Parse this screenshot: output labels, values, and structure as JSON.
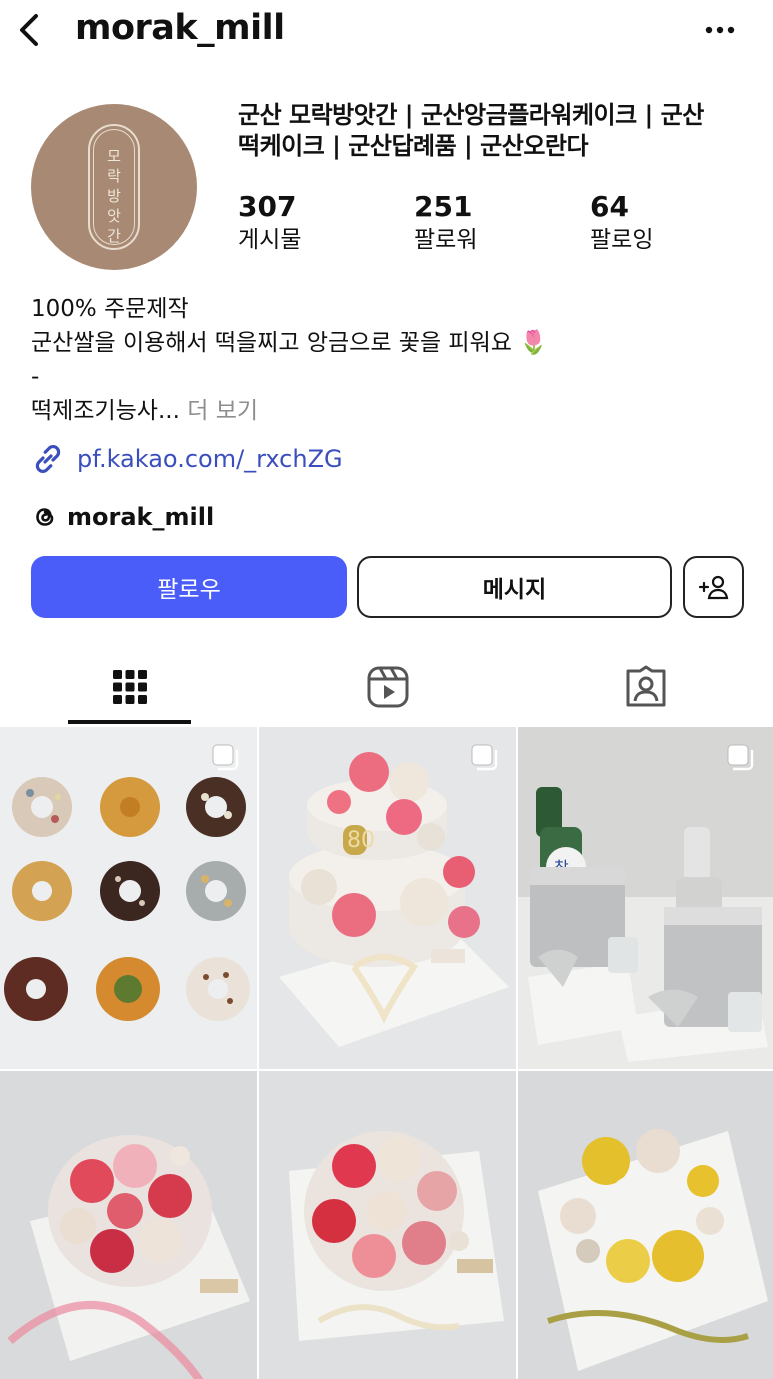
{
  "header": {
    "username": "morak_mill"
  },
  "avatar": {
    "text": [
      "모",
      "락",
      "방",
      "앗",
      "간"
    ]
  },
  "profile": {
    "name_line1": "군산 모락방앗간 | 군산앙금플라워케이크 | 군산",
    "name_line2": "떡케이크 | 군산답례품 | 군산오란다"
  },
  "stats": {
    "posts": {
      "value": "307",
      "label": "게시물"
    },
    "followers": {
      "value": "251",
      "label": "팔로워"
    },
    "following": {
      "value": "64",
      "label": "팔로잉"
    }
  },
  "bio": {
    "line1": "100% 주문제작",
    "line2": "군산쌀을 이용해서 떡을찌고 앙금으로 꽃을 피워요 🌷",
    "line3": "-",
    "line4": "떡제조기능사...",
    "more_label": "더 보기"
  },
  "link": {
    "url": "pf.kakao.com/_rxchZG",
    "icon": "link-icon"
  },
  "threads": {
    "handle": "morak_mill",
    "icon": "threads-icon"
  },
  "buttons": {
    "follow": "팔로우",
    "message": "메시지",
    "add_user_icon": "add-user-icon"
  },
  "tabs": [
    {
      "name": "posts-grid",
      "icon": "grid-icon",
      "active": true
    },
    {
      "name": "reels",
      "icon": "reels-icon",
      "active": false
    },
    {
      "name": "tagged",
      "icon": "tagged-icon",
      "active": false
    }
  ],
  "posts": [
    {
      "subject": "rice cake wreaths",
      "multi": true
    },
    {
      "subject": "two-tier flower cake",
      "multi": true
    },
    {
      "subject": "soju bucket cakes",
      "multi": true
    },
    {
      "subject": "red rose bouquet cake",
      "multi": false
    },
    {
      "subject": "red and pink flower cake",
      "multi": false
    },
    {
      "subject": "yellow flower wreath cake",
      "multi": false
    }
  ],
  "colors": {
    "follow_button": "#4a5df9",
    "link": "#3a4fbd",
    "avatar_bg": "#a88a74",
    "muted": "#8e8e8e"
  }
}
